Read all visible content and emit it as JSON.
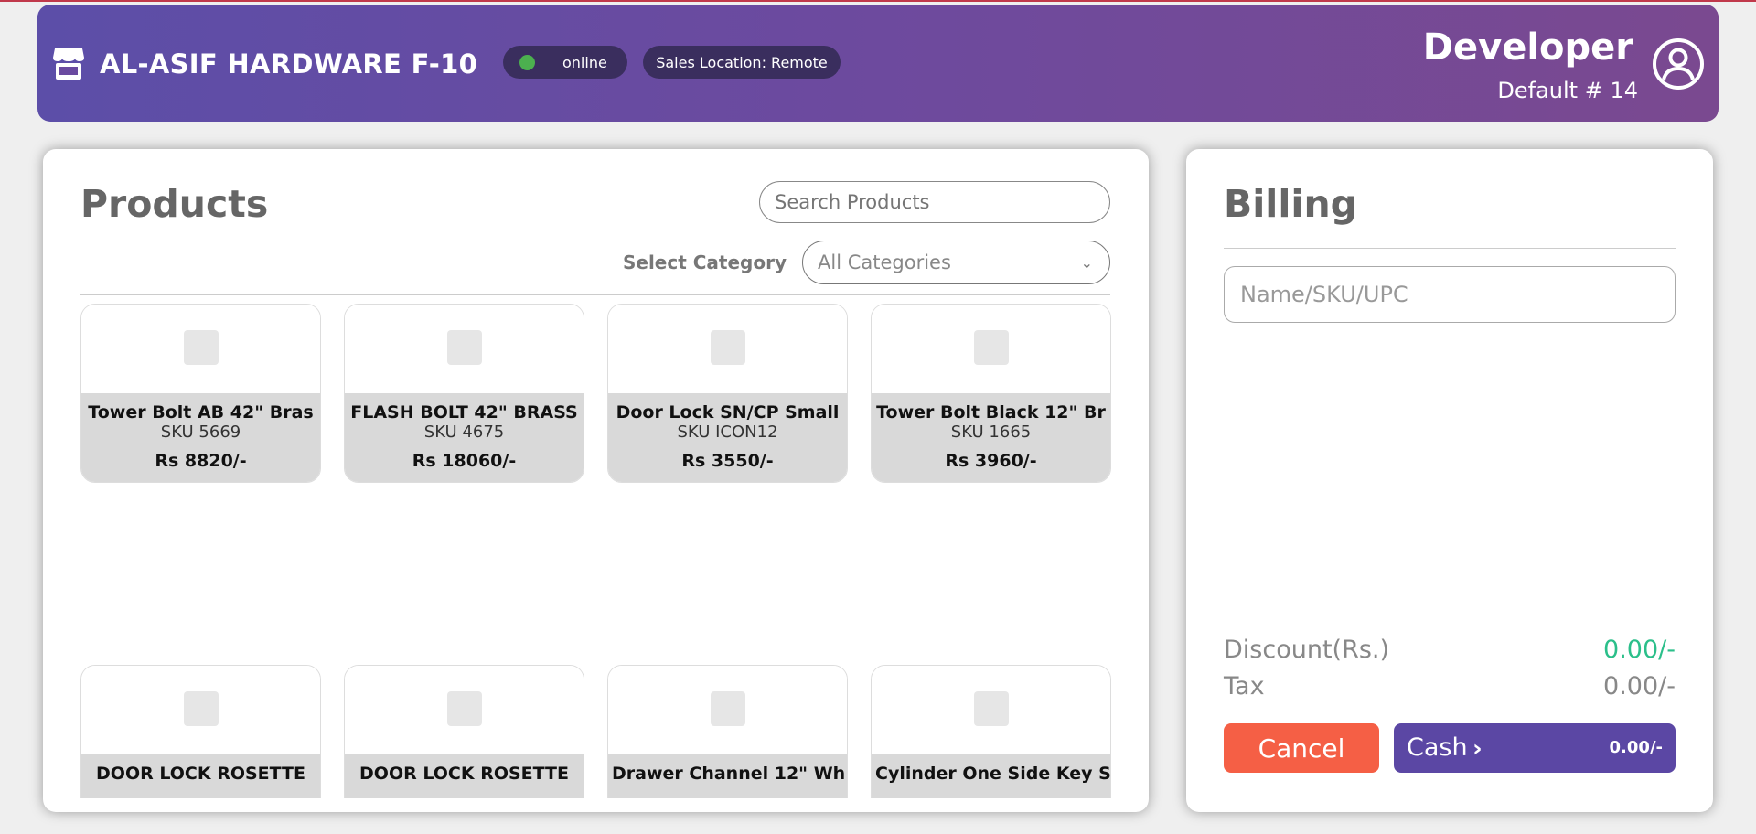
{
  "header": {
    "store_icon": "store-icon",
    "store_name": "AL-ASIF HARDWARE F-10",
    "status_label": "online",
    "status_color": "#4cb04f",
    "location_label": "Sales Location: Remote",
    "user_name": "Developer",
    "user_sub": "Default # 14",
    "user_icon": "user-circle-icon"
  },
  "products": {
    "title": "Products",
    "search_placeholder": "Search Products",
    "category_label": "Select Category",
    "category_selected": "All Categories",
    "items": [
      {
        "name": "Tower Bolt AB 42\" Bras",
        "sku": "SKU 5669",
        "price": "Rs 8820/-"
      },
      {
        "name": "FLASH BOLT 42\" BRASS",
        "sku": "SKU 4675",
        "price": "Rs 18060/-"
      },
      {
        "name": "Door Lock SN/CP Small",
        "sku": "SKU ICON12",
        "price": "Rs 3550/-"
      },
      {
        "name": "Tower Bolt Black 12\" Br",
        "sku": "SKU 1665",
        "price": "Rs 3960/-"
      },
      {
        "name": "DOOR LOCK ROSETTE"
      },
      {
        "name": "DOOR LOCK ROSETTE"
      },
      {
        "name": "Drawer Channel 12\" Wh"
      },
      {
        "name": "Cylinder One Side Key S"
      }
    ]
  },
  "billing": {
    "title": "Billing",
    "input_placeholder": "Name/SKU/UPC",
    "discount_label": "Discount(Rs.)",
    "discount_value": "0.00/-",
    "tax_label": "Tax",
    "tax_value": "0.00/-",
    "cancel_label": "Cancel",
    "cash_label": "Cash",
    "cash_total": "0.00/-",
    "colors": {
      "cancel": "#f55f45",
      "cash": "#5b47a4",
      "discount": "#2bbf8a"
    }
  }
}
